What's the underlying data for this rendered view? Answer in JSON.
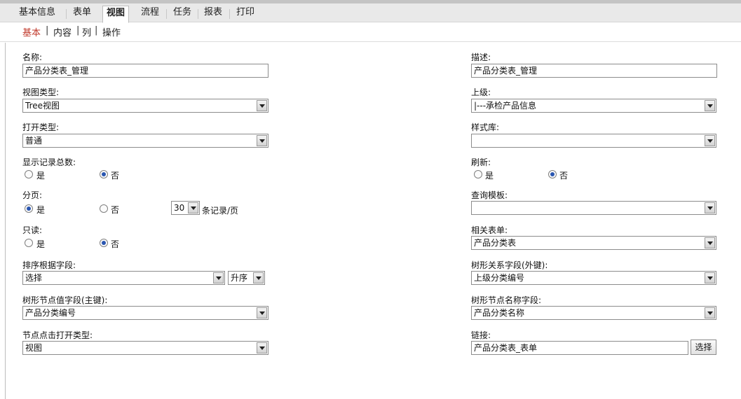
{
  "tabs": [
    "基本信息",
    "表单",
    "视图",
    "流程",
    "任务",
    "报表",
    "打印"
  ],
  "subtabs": [
    "基本",
    "内容",
    "列",
    "操作"
  ],
  "left": {
    "name_label": "名称:",
    "name_value": "产品分类表_管理",
    "view_type_label": "视图类型:",
    "view_type_value": "Tree视图",
    "open_type_label": "打开类型:",
    "open_type_value": "普通",
    "show_total_label": "显示记录总数:",
    "paging_label": "分页:",
    "page_size_value": "30",
    "page_size_suffix": "条记录/页",
    "readonly_label": "只读:",
    "sort_field_label": "排序根据字段:",
    "sort_field_value": "选择",
    "sort_order_value": "升序",
    "tree_value_field_label": "树形节点值字段(主键):",
    "tree_value_field_value": "产品分类编号",
    "node_click_label": "节点点击打开类型:",
    "node_click_value": "视图"
  },
  "right": {
    "desc_label": "描述:",
    "desc_value": "产品分类表_管理",
    "parent_label": "上级:",
    "parent_value": "|---承检产品信息",
    "style_lib_label": "样式库:",
    "style_lib_value": "",
    "refresh_label": "刷新:",
    "query_template_label": "查询模板:",
    "query_template_value": "",
    "related_form_label": "相关表单:",
    "related_form_value": "产品分类表",
    "tree_relation_label": "树形关系字段(外键):",
    "tree_relation_value": "上级分类编号",
    "tree_name_label": "树形节点名称字段:",
    "tree_name_value": "产品分类名称",
    "link_label": "链接:",
    "link_value": "产品分类表_表单",
    "select_button": "选择"
  },
  "radio": {
    "yes": "是",
    "no": "否"
  }
}
